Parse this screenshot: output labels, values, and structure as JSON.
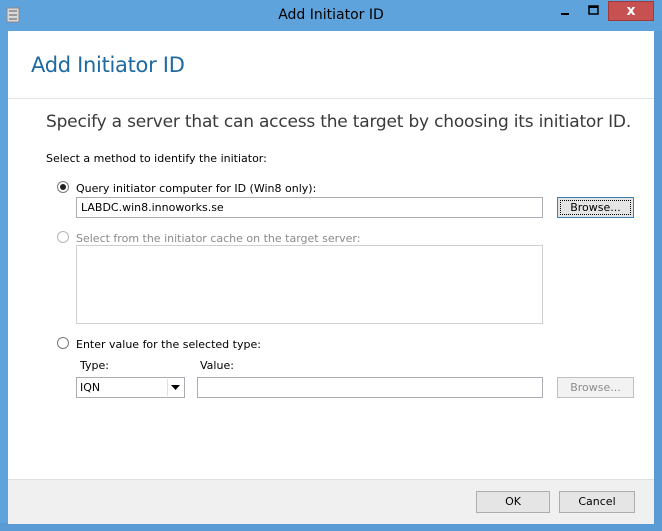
{
  "window": {
    "title": "Add Initiator ID",
    "close_glyph": "x"
  },
  "dialog": {
    "heading": "Add Initiator ID",
    "subtitle": "Specify a server that can access the target by choosing its initiator ID.",
    "method_prompt": "Select a method to identify the initiator:",
    "options": {
      "query": {
        "label": "Query initiator computer for ID (Win8 only):",
        "value": "LABDC.win8.innoworks.se",
        "browse_label": "Browse...",
        "selected": true
      },
      "cache": {
        "label": "Select from the initiator cache on the target server:",
        "selected": false,
        "enabled": false
      },
      "enter": {
        "label": "Enter value for the selected type:",
        "type_label": "Type:",
        "type_value": "IQN",
        "value_label": "Value:",
        "value": "",
        "browse_label": "Browse...",
        "selected": false
      }
    },
    "buttons": {
      "ok": "OK",
      "cancel": "Cancel"
    }
  },
  "colors": {
    "accent": "#5fa3dc",
    "heading": "#1e6aa1",
    "close": "#c75050"
  }
}
